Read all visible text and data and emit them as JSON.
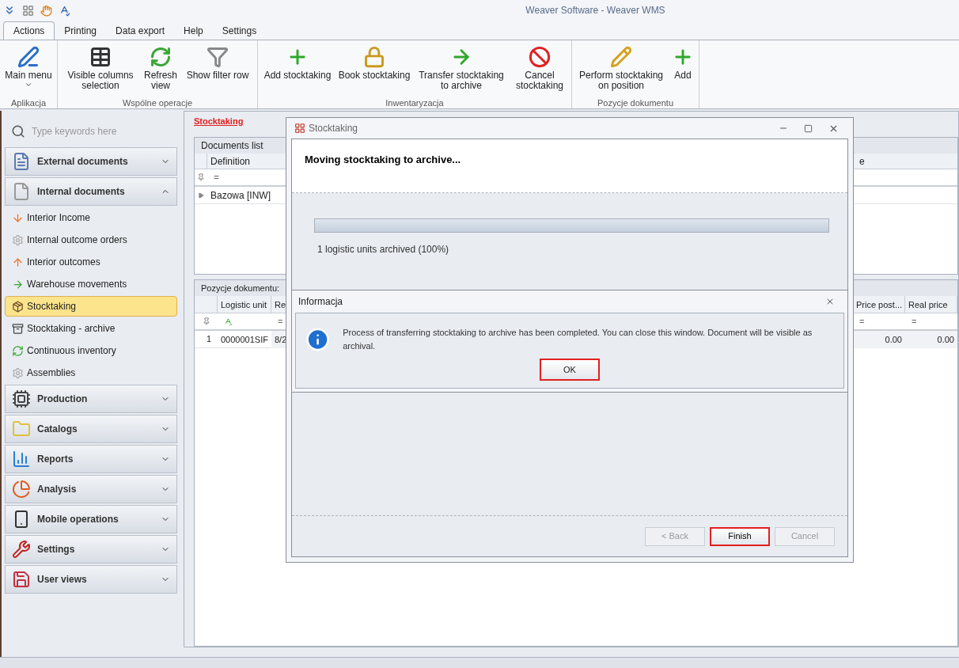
{
  "window": {
    "title": "Weaver Software - Weaver WMS"
  },
  "tabs": [
    {
      "label": "Actions",
      "selected": true
    },
    {
      "label": "Printing",
      "selected": false
    },
    {
      "label": "Data export",
      "selected": false
    },
    {
      "label": "Help",
      "selected": false
    },
    {
      "label": "Settings",
      "selected": false
    }
  ],
  "ribbon": {
    "groups": [
      {
        "label": "Aplikacja",
        "buttons": [
          {
            "label": "Main menu",
            "dropdown": true
          }
        ]
      },
      {
        "label": "Wspólne operacje",
        "buttons": [
          {
            "label": "Visible columns selection",
            "dropdown": false
          },
          {
            "label": "Refresh view",
            "dropdown": false
          },
          {
            "label": "Show filter row",
            "dropdown": false
          }
        ]
      },
      {
        "label": "Inwentaryzacja",
        "buttons": [
          {
            "label": "Add stocktaking",
            "dropdown": false
          },
          {
            "label": "Book stocktaking",
            "dropdown": false
          },
          {
            "label": "Transfer stocktaking to archive",
            "dropdown": false
          },
          {
            "label": "Cancel stocktaking",
            "dropdown": false
          }
        ]
      },
      {
        "label": "Pozycje dokumentu",
        "buttons": [
          {
            "label": "Perform stocktaking on position",
            "dropdown": false
          },
          {
            "label": "Add",
            "dropdown": false
          }
        ]
      }
    ]
  },
  "sidebar": {
    "search": {
      "placeholder": "Type keywords here"
    },
    "sections": [
      {
        "label": "External documents",
        "expanded": false
      },
      {
        "label": "Internal documents",
        "expanded": true,
        "items": [
          {
            "label": "Interior Income",
            "selected": false
          },
          {
            "label": "Internal outcome orders",
            "selected": false
          },
          {
            "label": "Interior outcomes",
            "selected": false
          },
          {
            "label": "Warehouse movements",
            "selected": false
          },
          {
            "label": "Stocktaking",
            "selected": true
          },
          {
            "label": "Stocktaking - archive",
            "selected": false
          },
          {
            "label": "Continuous inventory",
            "selected": false
          },
          {
            "label": "Assemblies",
            "selected": false
          }
        ]
      },
      {
        "label": "Production",
        "expanded": false
      },
      {
        "label": "Catalogs",
        "expanded": false
      },
      {
        "label": "Reports",
        "expanded": false
      },
      {
        "label": "Analysis",
        "expanded": false
      },
      {
        "label": "Mobile operations",
        "expanded": false
      },
      {
        "label": "Settings",
        "expanded": false
      },
      {
        "label": "User views",
        "expanded": false
      }
    ]
  },
  "page": {
    "title": "Stocktaking",
    "documents": {
      "title": "Documents list",
      "columns": [
        "Definition",
        "e"
      ],
      "filter": [
        {
          "kind": "equals",
          "text": "="
        }
      ],
      "rows": [
        [
          "Bazowa [INW]"
        ]
      ]
    },
    "positions": {
      "title": "Pozycje dokumentu:",
      "columns": [
        "Logistic unit",
        "Re",
        "Price post...",
        "Real price"
      ],
      "filter": [
        {
          "kind": "text"
        },
        {
          "kind": "equals",
          "text": "="
        },
        {
          "kind": "equals",
          "text": "="
        },
        {
          "kind": "equals",
          "text": "="
        }
      ],
      "rows": [
        {
          "number": "1",
          "cells": [
            "0000001SIF",
            "8/2",
            "0.00",
            "0.00"
          ]
        }
      ]
    }
  },
  "dialog": {
    "title": "Stocktaking",
    "heading": "Moving stocktaking to archive...",
    "progress": {
      "level": 1
    },
    "status": "1 logistic units archived (100%)",
    "info": {
      "title": "Informacja",
      "message": "Process of transferring stocktaking to archive has been completed. You can close this window. Document will be visible as archival.",
      "button": {
        "label": "OK",
        "highlighted": true
      }
    },
    "buttons": [
      {
        "label": "< Back",
        "disabled": true,
        "highlighted": false
      },
      {
        "label": "Finish",
        "disabled": false,
        "highlighted": true
      },
      {
        "label": "Cancel",
        "disabled": true,
        "highlighted": false
      }
    ]
  }
}
